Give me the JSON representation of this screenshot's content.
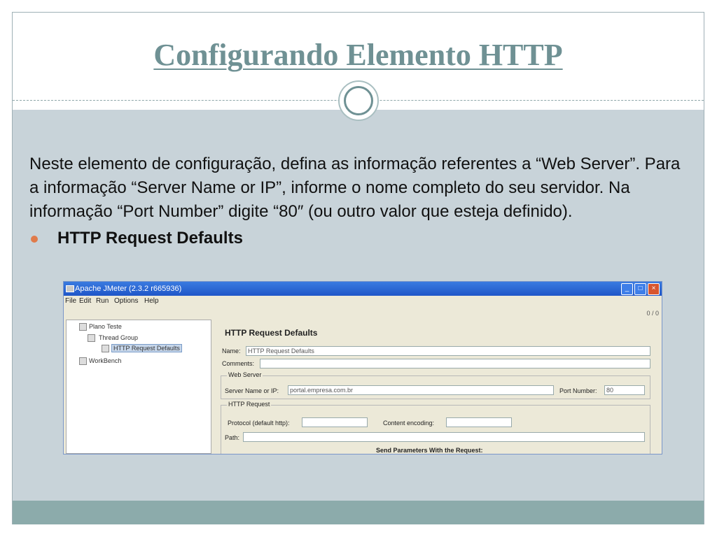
{
  "slide": {
    "title": "Configurando Elemento HTTP",
    "bullet_heading": "HTTP Request Defaults",
    "paragraph": "Neste elemento de configuração, defina as informação referentes a “Web Server”. Para a informação “Server Name or IP”, informe o nome completo do seu servidor. Na informação “Port Number” digite “80″ (ou outro valor que esteja definido).",
    "colors": {
      "title": "#6f9194",
      "content_bg": "#c8d3d9",
      "bottom_bar": "#8cabab",
      "bullet": "#e07b4b"
    }
  },
  "window": {
    "title": "Apache JMeter (2.3.2 r665936)",
    "controls": [
      "minimize-icon",
      "maximize-icon",
      "close-icon"
    ],
    "menu": [
      "File",
      "Edit",
      "Run",
      "Options",
      "Help"
    ],
    "counter": "0 / 0",
    "tree": [
      {
        "label": "Plano Teste",
        "icon": "test-plan-icon"
      },
      {
        "label": "Thread Group",
        "icon": "thread-group-icon"
      },
      {
        "label": "HTTP Request Defaults",
        "icon": "config-icon",
        "selected": true
      },
      {
        "label": "WorkBench",
        "icon": "workbench-icon"
      }
    ],
    "panel": {
      "heading": "HTTP Request Defaults",
      "name_label": "Name:",
      "name_value": "HTTP Request Defaults",
      "comments_label": "Comments:",
      "web_server_group": "Web Server",
      "server_label": "Server Name or IP:",
      "server_value": "portal.empresa.com.br",
      "port_label": "Port Number:",
      "port_value": "80",
      "http_request_group": "HTTP Request",
      "protocol_label": "Protocol (default http):",
      "encoding_label": "Content encoding:",
      "path_label": "Path:",
      "send_params_label": "Send Parameters With the Request:"
    }
  }
}
